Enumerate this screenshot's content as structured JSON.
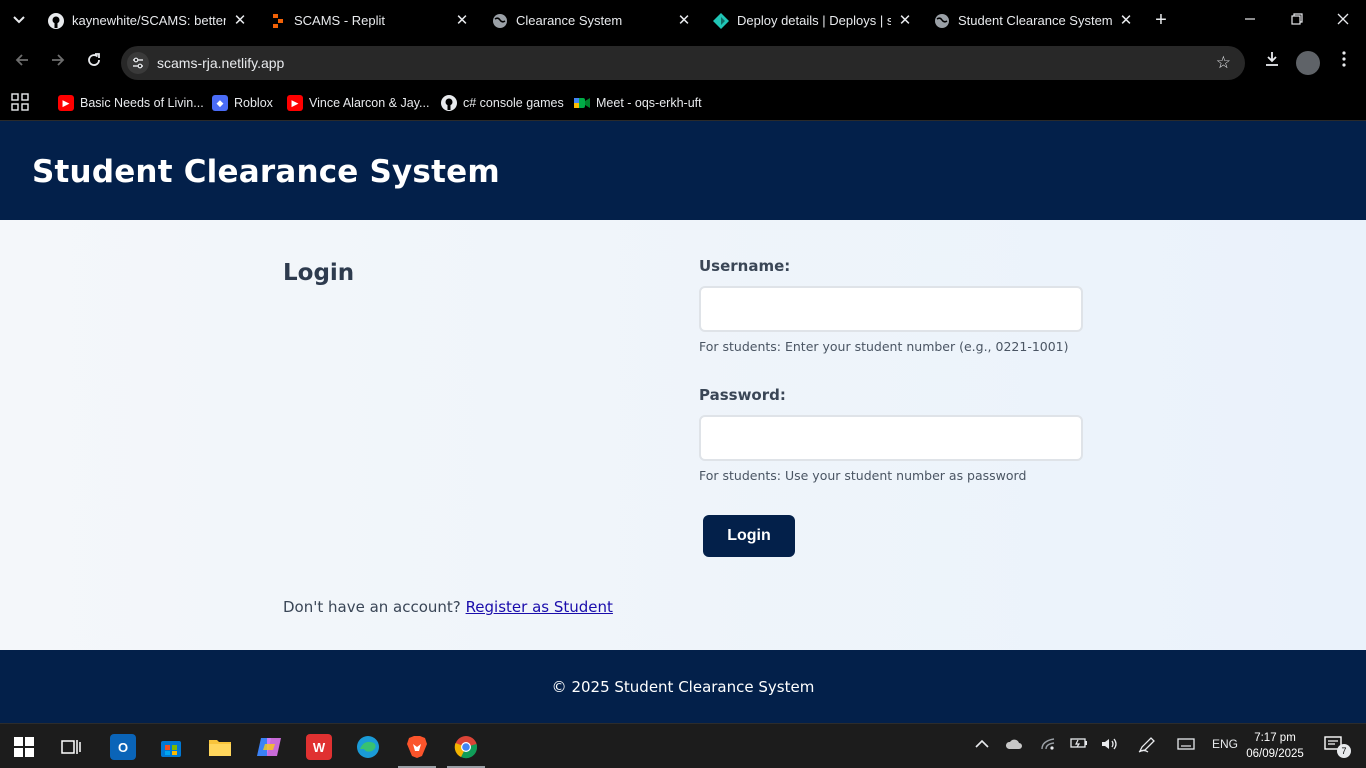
{
  "browser": {
    "tabs": [
      {
        "title": "kaynewhite/SCAMS: better c",
        "icon": "github-icon"
      },
      {
        "title": "SCAMS - Replit",
        "icon": "replit-icon"
      },
      {
        "title": "Clearance System",
        "icon": "globe-icon"
      },
      {
        "title": "Deploy details | Deploys | sc",
        "icon": "netlify-icon"
      },
      {
        "title": "Student Clearance System",
        "icon": "globe-icon"
      }
    ],
    "address": "scams-rja.netlify.app",
    "bookmarks": [
      {
        "label": "Basic Needs of Livin...",
        "icon": "youtube-icon"
      },
      {
        "label": "Roblox",
        "icon": "roblox-icon"
      },
      {
        "label": "Vince Alarcon & Jay...",
        "icon": "youtube-icon"
      },
      {
        "label": "c# console games",
        "icon": "github-icon"
      },
      {
        "label": "Meet - oqs-erkh-uft",
        "icon": "meet-icon"
      }
    ]
  },
  "app": {
    "header_title": "Student Clearance System",
    "login_title": "Login",
    "username_label": "Username:",
    "username_value": "",
    "username_hint": "For students: Enter your student number (e.g., 0221-1001)",
    "password_label": "Password:",
    "password_value": "",
    "password_hint": "For students: Use your student number as password",
    "login_button": "Login",
    "register_prompt": "Don't have an account?",
    "register_link": "Register as Student",
    "footer": "© 2025 Student Clearance System"
  },
  "taskbar": {
    "language": "ENG",
    "time": "7:17 pm",
    "date": "06/09/2025",
    "notifications": "7"
  },
  "colors": {
    "brand_navy": "#03204a",
    "page_bg": "#f4f7fa",
    "link": "#1a0dab"
  }
}
